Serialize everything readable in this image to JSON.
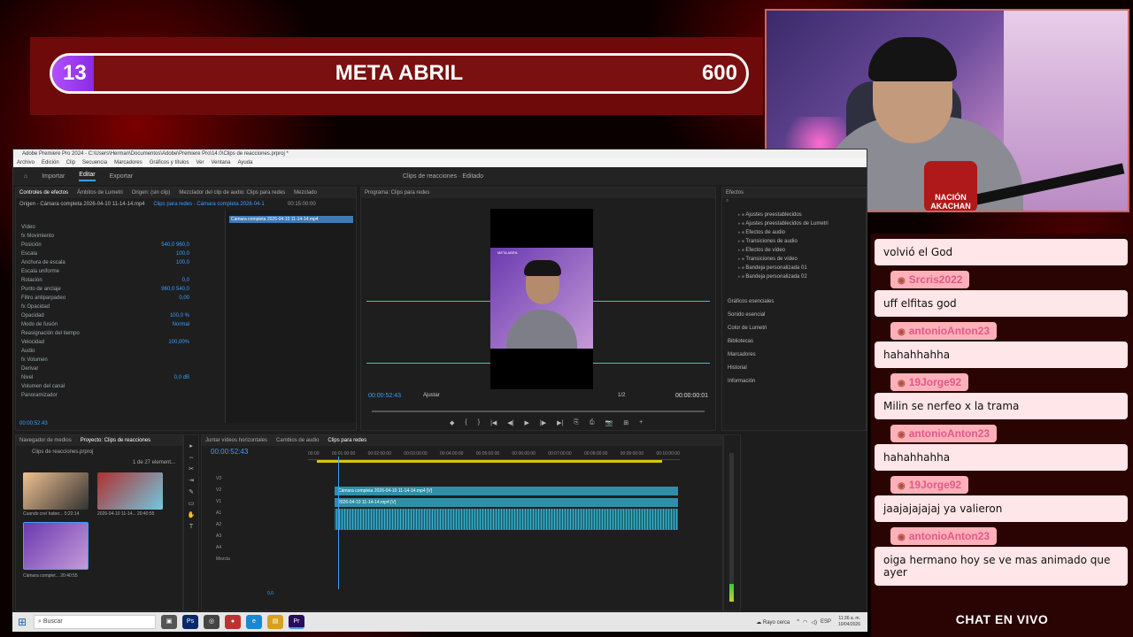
{
  "goal": {
    "current": "13",
    "title": "META ABRIL",
    "target": "600",
    "progress_fraction": 0.022
  },
  "webcam": {
    "logo_text": "NACIÓN AKACHAN"
  },
  "premiere": {
    "title": "Adobe Premiere Pro 2024 - C:\\Users\\Herman\\Documentos\\Adobe\\Premiere Pro\\14.0\\Clips de reacciones.prproj *",
    "menu": [
      "Archivo",
      "Edición",
      "Clip",
      "Secuencia",
      "Marcadores",
      "Gráficos y títulos",
      "Ver",
      "Ventana",
      "Ayuda"
    ],
    "workspace_tabs": [
      "Importar",
      "Editar",
      "Exportar"
    ],
    "active_tab": "Editar",
    "center_title": "Clips de reacciones",
    "center_sub": "Editado",
    "fx_panel_tabs": [
      "Controles de efectos",
      "Ámbitos de Lumetri",
      "Origen: (sin clip)",
      "Mezclador del clip de audio: Clips para redes",
      "Mezclado"
    ],
    "fx_source": "Origen - Cámara completa 2026-04-10 11-14-14.mp4",
    "fx_seq": "Clips para redes - Cámara completa 2026-04-1",
    "fx_timecode": "00:15:00:00",
    "fx_clipbar": "Cámara completa 2026-04-10 11-14-14.mp4",
    "fx_rows": [
      {
        "label": "Vídeo",
        "value": ""
      },
      {
        "label": "fx  Movimiento",
        "value": ""
      },
      {
        "label": "Posición",
        "value": "540,0   960,0"
      },
      {
        "label": "Escala",
        "value": "100,0"
      },
      {
        "label": "Anchura de escala",
        "value": "100,0"
      },
      {
        "label": "Escala uniforme",
        "value": ""
      },
      {
        "label": "Rotación",
        "value": "0,0"
      },
      {
        "label": "Punto de anclaje",
        "value": "960,0   540,0"
      },
      {
        "label": "Filtro antiparpadeo",
        "value": "0,00"
      },
      {
        "label": "fx  Opacidad",
        "value": ""
      },
      {
        "label": "Opacidad",
        "value": "100,0 %"
      },
      {
        "label": "Modo de fusión",
        "value": "Normal"
      },
      {
        "label": "Reasignación del tiempo",
        "value": ""
      },
      {
        "label": "Velocidad",
        "value": "100,00%"
      },
      {
        "label": "Audio",
        "value": ""
      },
      {
        "label": "fx  Volumen",
        "value": ""
      },
      {
        "label": "Derivar",
        "value": ""
      },
      {
        "label": "Nivel",
        "value": "0,0 dB"
      },
      {
        "label": "Volumen del canal",
        "value": ""
      },
      {
        "label": "Panoramizador",
        "value": ""
      }
    ],
    "fx_time": "00:00:52:43",
    "program": {
      "title": "Programa: Clips para redes",
      "timecode": "00:00:52:43",
      "fit": "Ajustar",
      "resolution": "1/2",
      "duration": "00:00:00:01",
      "frame_caption": "META ABRIL",
      "controls": [
        "◆",
        "{",
        "}",
        "|◀",
        "◀|",
        "▶",
        "|▶",
        "▶|",
        "⎘",
        "⎙",
        "📷",
        "⊞",
        "+"
      ]
    },
    "effects": {
      "title": "Efectos",
      "folders": [
        "Ajustes preestablecidos",
        "Ajustes preestablecidos de Lumetri",
        "Efectos de audio",
        "Transiciones de audio",
        "Efectos de vídeo",
        "Transiciones de vídeo",
        "Bandeja personalizada 01",
        "Bandeja personalizada 02"
      ],
      "side_panels": [
        "Gráficos esenciales",
        "Sonido esencial",
        "Color de Lumetri",
        "Bibliotecas",
        "Marcadores",
        "Historial",
        "Información"
      ]
    },
    "project": {
      "tabs": [
        "Navegador de medios",
        "Proyecto: Clips de reacciones"
      ],
      "file": "Clips de reacciones.prproj",
      "count": "1 de 27 element...",
      "items": [
        {
          "name": "Cuando creí haber...",
          "duration": "5:22:14"
        },
        {
          "name": "2026-04-10 11-14...",
          "duration": "20:40:55"
        },
        {
          "name": "Cámara complet...",
          "duration": "20:40:55"
        }
      ]
    },
    "timeline": {
      "tabs": [
        "Juntar vídeos horizontales",
        "Cambios de audio",
        "Clips para redes"
      ],
      "timecode": "00:00:52:43",
      "ruler": [
        "00:00",
        "00:01:00:00",
        "00:02:00:00",
        "00:03:00:00",
        "00:04:00:00",
        "00:05:00:00",
        "00:06:00:00",
        "00:07:00:00",
        "00:08:00:00",
        "00:09:00:00",
        "00:10:00:00"
      ],
      "tracks": [
        "V3",
        "V2",
        "V1",
        "A1",
        "A2",
        "A3",
        "A4",
        "Mezcla"
      ],
      "mix_value": "0,0",
      "clip_v2": "Cámara completa 2026-04-10 11-14-14.mp4 [V]",
      "clip_v1": "2026-04-10 11-14-14.mp4 [V]"
    }
  },
  "taskbar": {
    "search_placeholder": "Buscar",
    "weather": "Rayo cerca",
    "lang": "ESP",
    "time": "11:36 a. m.",
    "date": "10/04/2026"
  },
  "chat": {
    "messages": [
      {
        "user": "",
        "text": "volvió el God"
      },
      {
        "user": "Srcris2022",
        "text": "uff elfitas god"
      },
      {
        "user": "antonioAnton23",
        "text": "hahahhahha"
      },
      {
        "user": "19Jorge92",
        "text": "Milin se nerfeo x la trama"
      },
      {
        "user": "antonioAnton23",
        "text": "hahahhahha"
      },
      {
        "user": "19Jorge92",
        "text": "jaajajajajaj ya valieron"
      },
      {
        "user": "antonioAnton23",
        "text": "oiga hermano hoy se ve mas animado que ayer"
      }
    ],
    "footer": "CHAT EN VIVO"
  }
}
